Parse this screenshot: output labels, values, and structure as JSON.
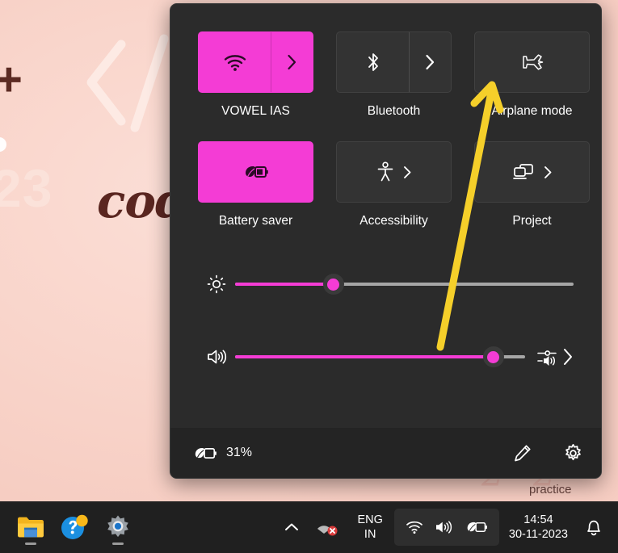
{
  "wallpaper": {
    "plus": "+",
    "year": "23",
    "cursive_word": "cod",
    "practice_word": "practice",
    "top_faint": "",
    "swirl_a": "2",
    "swirl_b": "2",
    "bg_color": "#f9d5cb",
    "accent_text_color": "#5a2620"
  },
  "quick_settings": {
    "accent_color": "#f43cd5",
    "panel_bg": "#2b2b2b",
    "footer_bg": "#242424",
    "tiles": [
      {
        "id": "wifi",
        "label": "VOWEL IAS",
        "icon": "wifi-icon",
        "state": "on",
        "has_chevron": true,
        "chevron_icon": "chevron-right-icon",
        "chevron_style": "split"
      },
      {
        "id": "bluetooth",
        "label": "Bluetooth",
        "icon": "bluetooth-icon",
        "state": "off",
        "has_chevron": true,
        "chevron_icon": "chevron-right-icon",
        "chevron_style": "split"
      },
      {
        "id": "airplane-mode",
        "label": "Airplane mode",
        "icon": "airplane-icon",
        "state": "off",
        "has_chevron": false,
        "chevron_icon": "",
        "chevron_style": "none"
      },
      {
        "id": "battery-saver",
        "label": "Battery saver",
        "icon": "battery-saver-icon",
        "state": "on",
        "has_chevron": false,
        "chevron_icon": "",
        "chevron_style": "none"
      },
      {
        "id": "accessibility",
        "label": "Accessibility",
        "icon": "accessibility-icon",
        "state": "off",
        "has_chevron": true,
        "chevron_icon": "chevron-right-icon",
        "chevron_style": "inline"
      },
      {
        "id": "project",
        "label": "Project",
        "icon": "project-icon",
        "state": "off",
        "has_chevron": true,
        "chevron_icon": "chevron-right-icon",
        "chevron_style": "inline"
      }
    ],
    "sliders": [
      {
        "id": "brightness",
        "icon": "brightness-icon",
        "value": 29,
        "min": 0,
        "max": 100
      },
      {
        "id": "volume",
        "icon": "volume-icon",
        "value": 89,
        "min": 0,
        "max": 100,
        "extra_icon": "audio-mixer-icon",
        "extra_chevron": "chevron-right-icon"
      }
    ],
    "footer": {
      "battery_icon": "battery-saver-icon",
      "battery_percent": "31%",
      "edit_label": "Edit quick settings",
      "edit_icon": "pencil-icon",
      "settings_label": "Settings",
      "settings_icon": "gear-icon"
    }
  },
  "annotation": {
    "type": "arrow",
    "color": "#f5cf2a",
    "points_to": "airplane-mode"
  },
  "taskbar": {
    "bg_color": "#202020",
    "apps": [
      {
        "id": "file-explorer",
        "name": "file-explorer-icon",
        "running": true
      },
      {
        "id": "get-help",
        "name": "get-help-icon",
        "running": false,
        "badge": true
      },
      {
        "id": "settings",
        "name": "settings-gear-icon",
        "running": true
      }
    ],
    "tray": {
      "overflow_icon": "chevron-up-icon",
      "network_error_icon": "network-error-icon",
      "language": {
        "line1": "ENG",
        "line2": "IN"
      },
      "status_icons": [
        "wifi-icon",
        "volume-icon",
        "battery-saver-icon"
      ],
      "clock": {
        "time": "14:54",
        "date": "30-11-2023"
      },
      "notifications_icon": "bell-icon"
    }
  }
}
